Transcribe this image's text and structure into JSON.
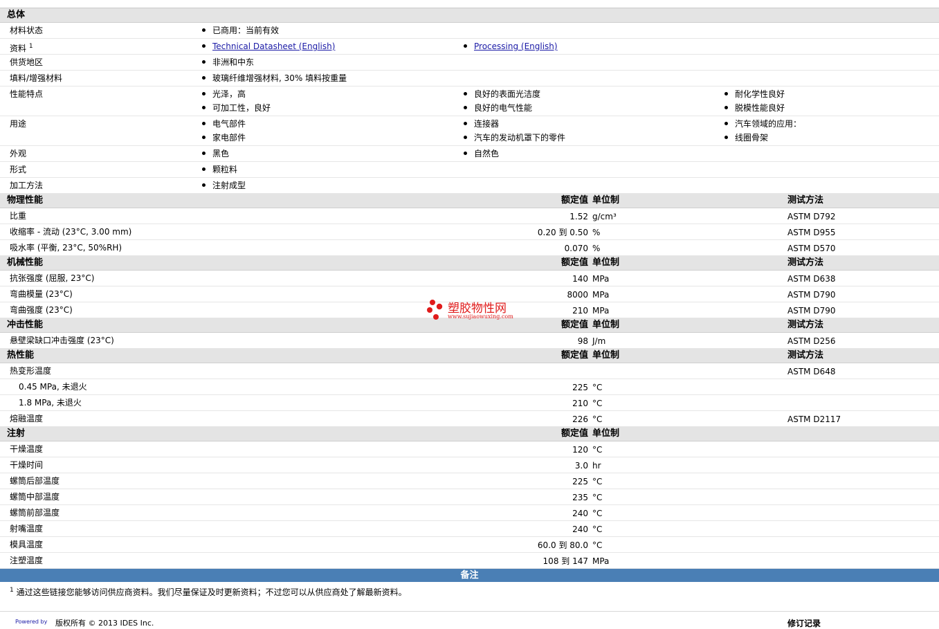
{
  "general": {
    "section": "总体",
    "material_status": {
      "label": "材料状态",
      "value": "已商用：当前有效"
    },
    "literature": {
      "label": "资料",
      "sup": "1",
      "link1": "Technical Datasheet (English)",
      "link2": "Processing (English)"
    },
    "availability": {
      "label": "供货地区",
      "value": "非洲和中东"
    },
    "filler": {
      "label": "填料/增强材料",
      "value": "玻璃纤维增强材料, 30% 填料按重量"
    },
    "features": {
      "label": "性能特点",
      "items": [
        "光泽，高",
        "良好的表面光洁度",
        "耐化学性良好",
        "可加工性，良好",
        "良好的电气性能",
        "脱模性能良好"
      ]
    },
    "uses": {
      "label": "用途",
      "items": [
        "电气部件",
        "连接器",
        "汽车领域的应用：",
        "家电部件",
        "汽车的发动机罩下的零件",
        "线圈骨架"
      ]
    },
    "appearance": {
      "label": "外观",
      "items": [
        "黑色",
        "自然色"
      ]
    },
    "form": {
      "label": "形式",
      "value": "颗粒料"
    },
    "processing": {
      "label": "加工方法",
      "value": "注射成型"
    }
  },
  "headers": {
    "nominal": "额定值",
    "unit": "单位制",
    "method": "测试方法"
  },
  "physical": {
    "section": "物理性能",
    "rows": [
      {
        "label": "比重",
        "value": "1.52",
        "unit": "g/cm³",
        "method": "ASTM D792"
      },
      {
        "label": "收缩率 - 流动 (23°C, 3.00 mm)",
        "value": "0.20 到  0.50",
        "unit": "%",
        "method": "ASTM D955"
      },
      {
        "label": "吸水率 (平衡, 23°C, 50%RH)",
        "value": "0.070",
        "unit": "%",
        "method": "ASTM D570"
      }
    ]
  },
  "mechanical": {
    "section": "机械性能",
    "rows": [
      {
        "label": "抗张强度 (屈服, 23°C)",
        "value": "140",
        "unit": "MPa",
        "method": "ASTM D638"
      },
      {
        "label": "弯曲模量 (23°C)",
        "value": "8000",
        "unit": "MPa",
        "method": "ASTM D790"
      },
      {
        "label": "弯曲强度 (23°C)",
        "value": "210",
        "unit": "MPa",
        "method": "ASTM D790"
      }
    ]
  },
  "impact": {
    "section": "冲击性能",
    "rows": [
      {
        "label": "悬壁梁缺口冲击强度 (23°C)",
        "value": "98",
        "unit": "J/m",
        "method": "ASTM D256"
      }
    ]
  },
  "thermal": {
    "section": "热性能",
    "rows": [
      {
        "label": "热变形温度",
        "value": "",
        "unit": "",
        "method": "ASTM D648"
      },
      {
        "label": "0.45 MPa, 未退火",
        "value": "225",
        "unit": "°C",
        "method": ""
      },
      {
        "label": "1.8 MPa, 未退火",
        "value": "210",
        "unit": "°C",
        "method": ""
      },
      {
        "label": "熔融温度",
        "value": "226",
        "unit": "°C",
        "method": "ASTM D2117"
      }
    ]
  },
  "injection": {
    "section": "注射",
    "rows": [
      {
        "label": "干燥温度",
        "value": "120",
        "unit": "°C"
      },
      {
        "label": "干燥时间",
        "value": "3.0",
        "unit": "hr"
      },
      {
        "label": "螺筒后部温度",
        "value": "225",
        "unit": "°C"
      },
      {
        "label": "螺筒中部温度",
        "value": "235",
        "unit": "°C"
      },
      {
        "label": "螺筒前部温度",
        "value": "240",
        "unit": "°C"
      },
      {
        "label": "射嘴温度",
        "value": "240",
        "unit": "°C"
      },
      {
        "label": "模具温度",
        "value": "60.0 到  80.0",
        "unit": "°C"
      },
      {
        "label": "注塑温度",
        "value": "108 到  147",
        "unit": "MPa"
      }
    ]
  },
  "notes": {
    "title": "备注",
    "sup": "1",
    "text": "通过这些链接您能够访问供应商资料。我们尽量保证及时更新资料；不过您可以从供应商处了解最新资料。"
  },
  "footer": {
    "powered": "Powered by",
    "copyright": "版权所有 © 2013 IDES Inc.",
    "revision": "修订记录"
  },
  "watermark": {
    "name": "塑胶物性网",
    "url": "www.sujiaowuxing.com"
  },
  "colors": {
    "section_bg": "#e4e4e4",
    "notes_bar": "#4a7fb5",
    "link": "#1a1aa6",
    "watermark": "#e01b1b"
  }
}
